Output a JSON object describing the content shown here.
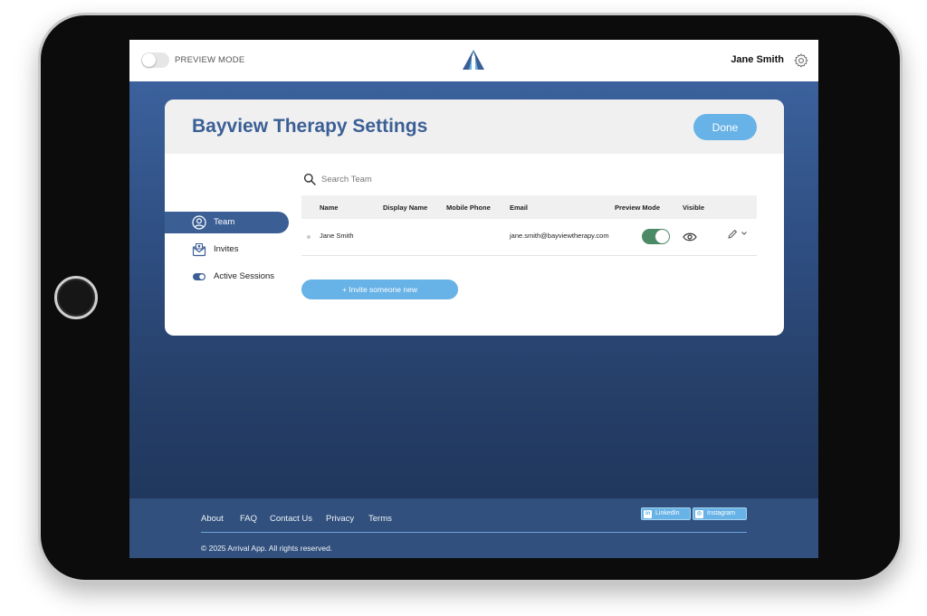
{
  "topbar": {
    "preview_mode_label": "PREVIEW MODE",
    "user_name": "Jane Smith"
  },
  "card": {
    "title": "Bayview Therapy Settings",
    "done_label": "Done"
  },
  "sidebar": {
    "items": [
      {
        "label": "Team",
        "icon": "user-circle-icon",
        "active": true
      },
      {
        "label": "Invites",
        "icon": "envelope-icon",
        "active": false
      },
      {
        "label": "Active Sessions",
        "icon": "toggle-icon",
        "active": false
      }
    ]
  },
  "search": {
    "placeholder": "Search Team"
  },
  "table": {
    "columns": [
      "Name",
      "Display Name",
      "Mobile Phone",
      "Email",
      "Preview Mode",
      "Visible"
    ],
    "rows": [
      {
        "name": "Jane Smith",
        "display_name": "",
        "mobile_phone": "",
        "email": "jane.smith@bayviewtherapy.com",
        "preview_mode": true,
        "visible": true
      }
    ]
  },
  "invite_label": "+ Invite someone new",
  "footer": {
    "links": [
      "About",
      "FAQ",
      "Contact Us",
      "Privacy",
      "Terms"
    ],
    "social": [
      "LinkedIn",
      "Instagram"
    ],
    "copyright": "© 2025 Arrival App. All rights reserved."
  },
  "colors": {
    "brand_blue": "#3b5f95",
    "accent_light_blue": "#67b2e6",
    "toggle_green": "#4c8a66",
    "footer_bg": "#31507d"
  }
}
